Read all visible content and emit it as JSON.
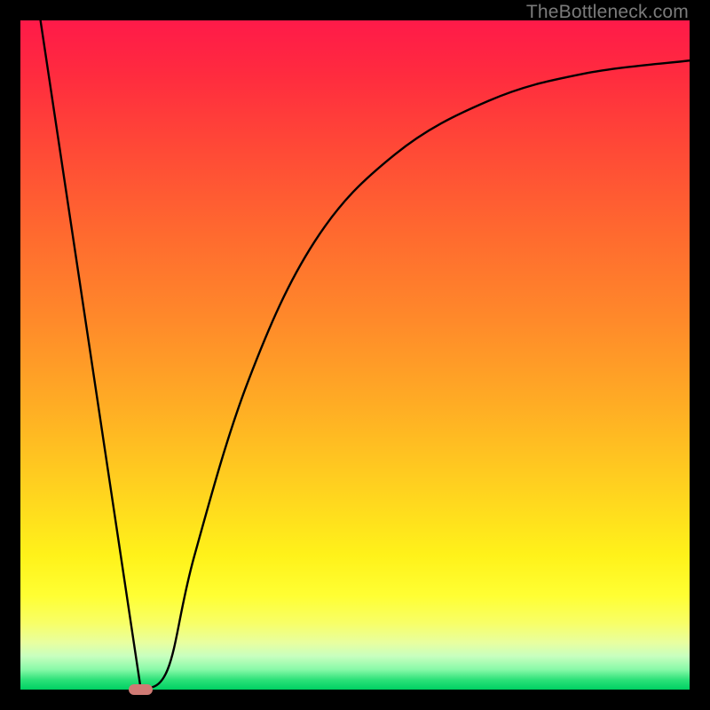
{
  "watermark": "TheBottleneck.com",
  "chart_data": {
    "type": "line",
    "title": "",
    "xlabel": "",
    "ylabel": "",
    "xlim": [
      0,
      100
    ],
    "ylim": [
      0,
      100
    ],
    "grid": false,
    "series": [
      {
        "name": "bottleneck-curve",
        "x": [
          3,
          18,
          22,
          26,
          34,
          44,
          56,
          70,
          84,
          100
        ],
        "values": [
          100,
          0,
          3,
          20,
          46,
          67,
          80,
          88,
          92,
          94
        ]
      }
    ],
    "annotations": [
      {
        "name": "marker-pill",
        "x": 18,
        "y": 0,
        "w": 3.6,
        "h": 1.6
      }
    ],
    "background_gradient": {
      "top": "#ff1a49",
      "upper_mid": "#ff8a2a",
      "mid": "#fff21a",
      "lower_mid": "#e8ffa0",
      "bottom": "#00d062"
    }
  }
}
